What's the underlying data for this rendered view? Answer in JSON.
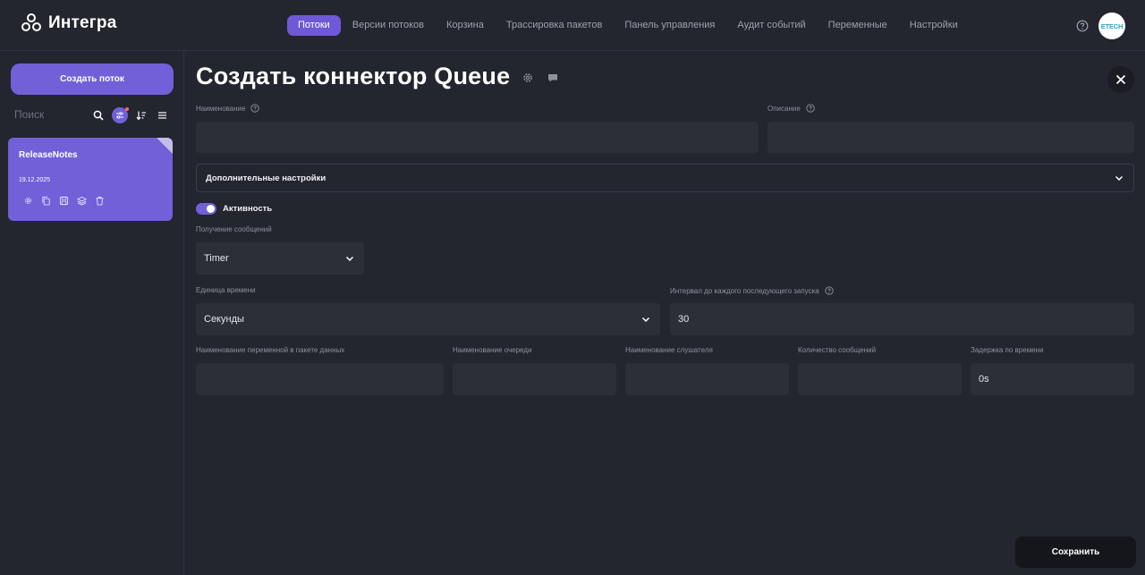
{
  "app": {
    "name": "Интегра"
  },
  "nav": {
    "items": [
      {
        "label": "Потоки"
      },
      {
        "label": "Версии потоков"
      },
      {
        "label": "Корзина"
      },
      {
        "label": "Трассировка пакетов"
      },
      {
        "label": "Панель управления"
      },
      {
        "label": "Аудит событий"
      },
      {
        "label": "Переменные"
      },
      {
        "label": "Настройки"
      }
    ],
    "active": "Потоки"
  },
  "user": {
    "avatar_text": "ETECH"
  },
  "sidebar": {
    "create_button": "Создать поток",
    "search_placeholder": "Поиск",
    "flows": [
      {
        "name": "ReleaseNotes",
        "date": "19.12.2025"
      }
    ]
  },
  "form": {
    "title": "Создать коннектор Queue",
    "name": {
      "label": "Наименование",
      "value": ""
    },
    "description": {
      "label": "Описание",
      "value": ""
    },
    "advanced_settings": "Дополнительные настройки",
    "activity": {
      "label": "Активность",
      "enabled": true
    },
    "receive_messages": {
      "label": "Получение сообщений",
      "value": "Timer"
    },
    "time_unit": {
      "label": "Единица времени",
      "value": "Секунды"
    },
    "interval": {
      "label": "Интервал до каждого последующего запуска",
      "value": "30"
    },
    "variable_name": {
      "label": "Наименование переменной в пакете данных",
      "value": ""
    },
    "queue_name": {
      "label": "Наименование очереди",
      "value": ""
    },
    "listener_name": {
      "label": "Наименование слушателя",
      "value": ""
    },
    "message_count": {
      "label": "Количество сообщений",
      "value": ""
    },
    "time_delay": {
      "label": "Задержка по времени",
      "value": "0s"
    },
    "save_button": "Сохранить"
  },
  "colors": {
    "accent": "#7160d8",
    "background": "#23252f",
    "field": "#2c2e38"
  }
}
